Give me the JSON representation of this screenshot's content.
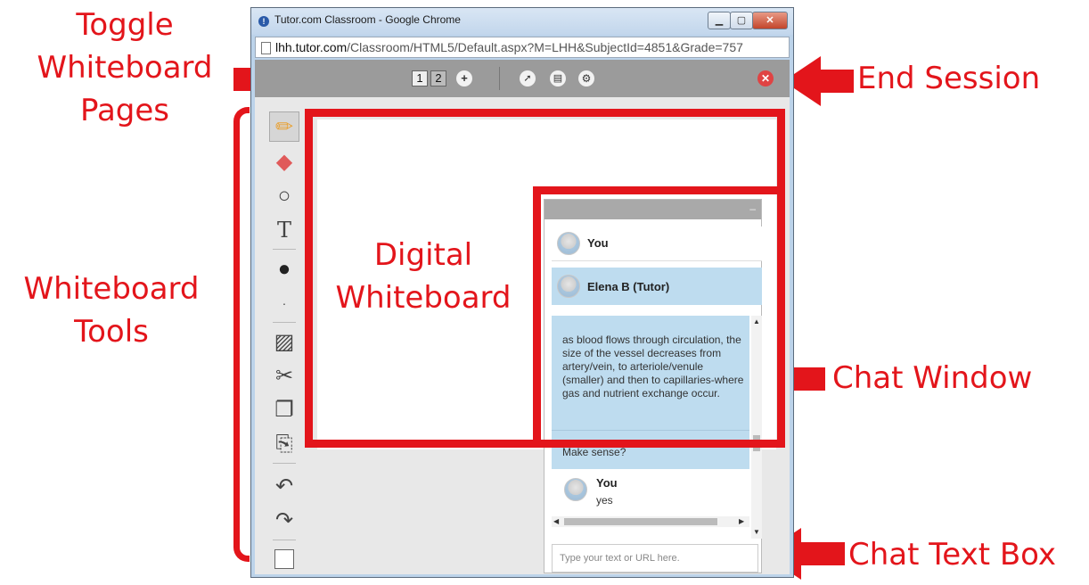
{
  "browser": {
    "title": "Tutor.com Classroom - Google Chrome",
    "url_host": "lhh.tutor.com",
    "url_path": "/Classroom/HTML5/Default.aspx?M=LHH&SubjectId=4851&Grade=757",
    "min_symbol": "▁",
    "max_symbol": "▢",
    "close_symbol": "✕"
  },
  "toolbar": {
    "pages": [
      "1",
      "2"
    ],
    "add_page": "+",
    "end_symbol": "✕"
  },
  "chat": {
    "header_symbol": "–",
    "participants": [
      {
        "name": "You"
      },
      {
        "name": "Elena B (Tutor)"
      }
    ],
    "message": "as blood flows through circulation, the size of the vessel decreases from artery/vein, to arteriole/venule (smaller) and then to capillaries-where gas and nutrient exchange occur.",
    "message2": "Make sense?",
    "reply_name": "You",
    "reply_text": "yes",
    "input_placeholder": "Type your text or URL here."
  },
  "callouts": {
    "toggle": "Toggle\nWhiteboard\nPages",
    "end_session": "End Session",
    "whiteboard_tools": "Whiteboard\nTools",
    "digital_whiteboard": "Digital\nWhiteboard",
    "chat_window": "Chat Window",
    "chat_text_box": "Chat Text Box"
  },
  "colors": {
    "callout_red": "#e3151b",
    "toolbar_gray": "#9b9b9b",
    "chat_blue": "#bedcef"
  }
}
